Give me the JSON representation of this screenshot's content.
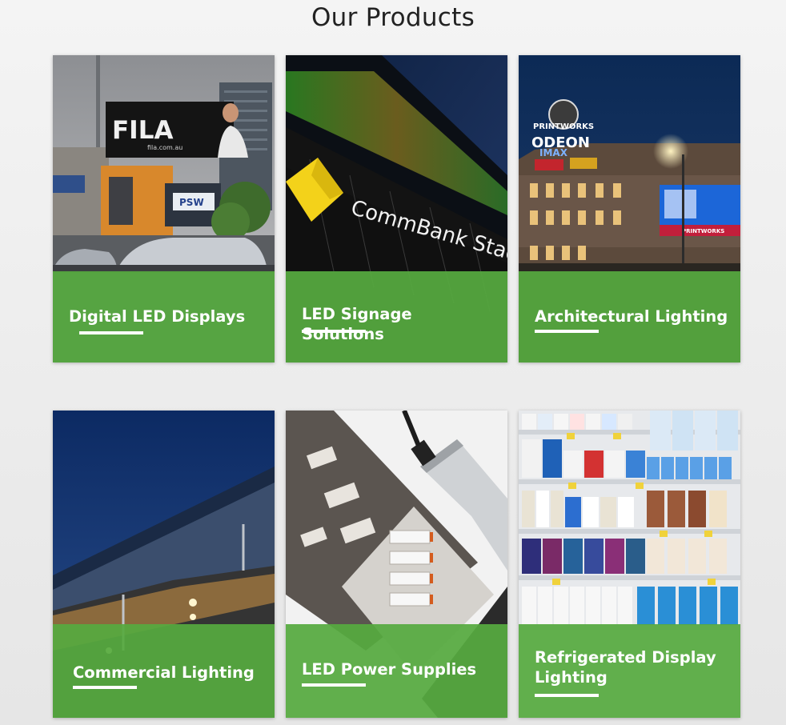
{
  "page": {
    "title": "Our Products"
  },
  "colors": {
    "accent_green": "#56aa40",
    "title_text": "#222222",
    "card_text": "#ffffff"
  },
  "products": [
    {
      "label": "Digital LED Displays",
      "image_text": [
        "FILA",
        "fila.com.au",
        "PSW"
      ]
    },
    {
      "label": "LED Signage Solutions",
      "image_text": [
        "CommBank Stadium"
      ]
    },
    {
      "label": "Architectural Lighting",
      "image_text": [
        "PRINTWORKS",
        "ODEON",
        "IMAX",
        "PRINTWORKS"
      ]
    },
    {
      "label": "Commercial Lighting"
    },
    {
      "label": "LED Power Supplies"
    },
    {
      "label": "Refrigerated Display Lighting"
    }
  ]
}
